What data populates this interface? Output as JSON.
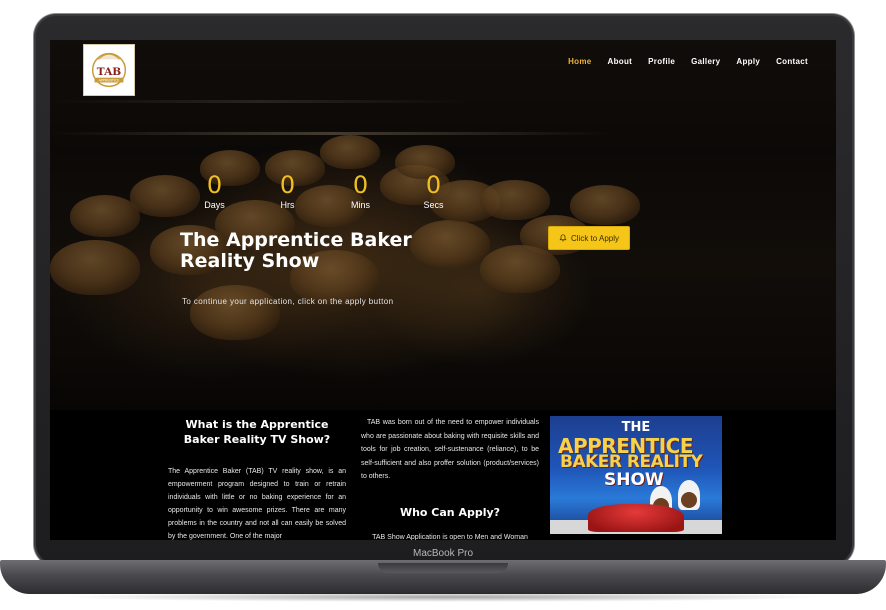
{
  "device": {
    "model_label": "MacBook Pro"
  },
  "site": {
    "logo_text": "TAB",
    "logo_subtext": "APPRENTICE",
    "nav": [
      {
        "label": "Home",
        "active": true
      },
      {
        "label": "About",
        "active": false
      },
      {
        "label": "Profile",
        "active": false
      },
      {
        "label": "Gallery",
        "active": false
      },
      {
        "label": "Apply",
        "active": false
      },
      {
        "label": "Contact",
        "active": false
      }
    ]
  },
  "hero": {
    "countdown": [
      {
        "value": "0",
        "label": "Days"
      },
      {
        "value": "0",
        "label": "Hrs"
      },
      {
        "value": "0",
        "label": "Mins"
      },
      {
        "value": "0",
        "label": "Secs"
      }
    ],
    "title": "The Apprentice Baker Reality Show",
    "apply_button_label": "Click to Apply",
    "subtitle": "To continue your application, click on the apply button"
  },
  "about": {
    "heading": "What is the Apprentice Baker Reality TV Show?",
    "body": "The Apprentice Baker (TAB) TV reality show, is an empowerment program designed to train or retrain individuals with little or no baking experience for an opportunity to win awesome prizes. There are many problems in the country and not all can easily be solved by the government. One of the major",
    "intro": "TAB was born out of the need to empower individuals who are passionate about baking with requisite skills and tools for job creation, self-sustenance (reliance), to be self-sufficient and also proffer solution (product/services) to others.",
    "who_heading": "Who Can Apply?",
    "who_body": "TAB Show Application is open to Men and Woman"
  },
  "poster": {
    "line1": "THE",
    "line2": "APPRENTICE",
    "line3": "BAKER REALITY",
    "line4": "SHOW"
  },
  "colors": {
    "accent": "#f0b432",
    "countdown": "#f0c020",
    "button": "#f5c518"
  }
}
